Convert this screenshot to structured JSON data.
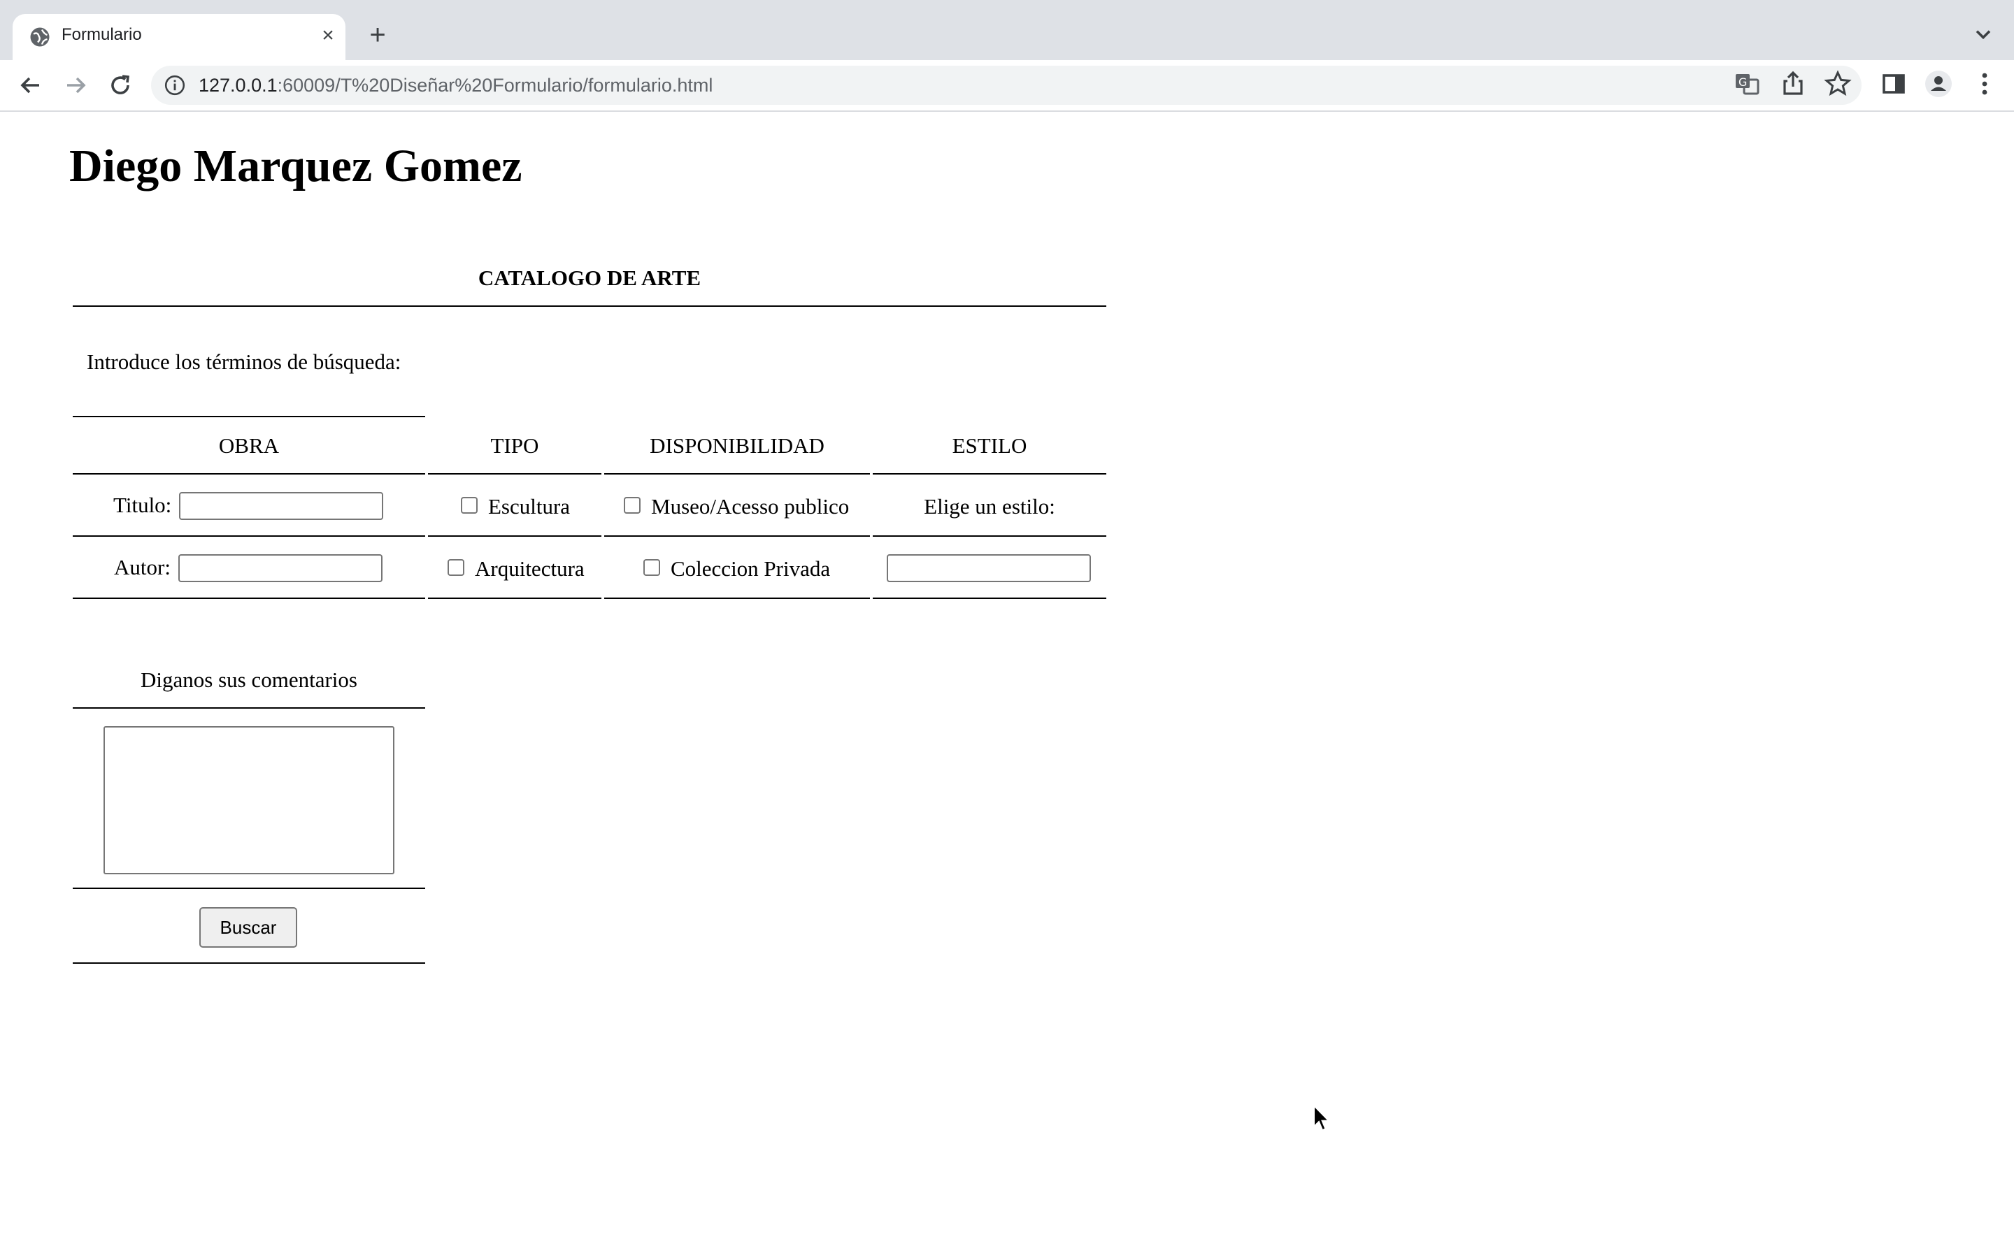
{
  "browser": {
    "tab_title": "Formulario",
    "url_host": "127.0.0.1",
    "url_rest": ":60009/T%20Diseñar%20Formulario/formulario.html"
  },
  "page": {
    "heading": "Diego Marquez Gomez",
    "catalog_title": "CATALOGO DE ARTE",
    "search_prompt": "Introduce los términos de búsqueda:",
    "columns": {
      "obra": "OBRA",
      "tipo": "TIPO",
      "disponibilidad": "DISPONIBILIDAD",
      "estilo": "ESTILO"
    },
    "fields": {
      "titulo_label": "Titulo:",
      "titulo_value": "",
      "autor_label": "Autor:",
      "autor_value": "",
      "estilo_value": ""
    },
    "tipo_options": [
      "Escultura",
      "Arquitectura"
    ],
    "tipo_checked": [
      false,
      false
    ],
    "disponibilidad_options": [
      "Museo/Acesso publico",
      "Coleccion Privada"
    ],
    "disponibilidad_checked": [
      false,
      false
    ],
    "estilo_prompt": "Elige un estilo:",
    "comments_label": "Diganos sus comentarios",
    "comments_value": "",
    "submit_label": "Buscar"
  }
}
